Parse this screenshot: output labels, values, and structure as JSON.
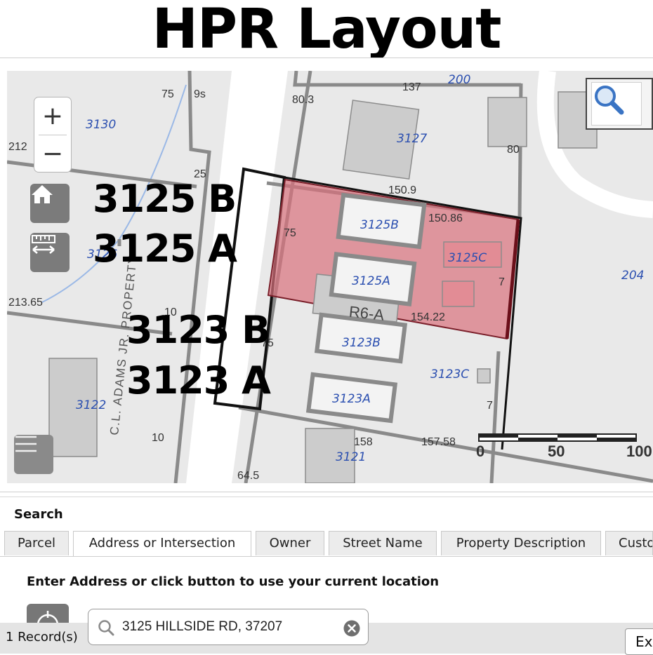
{
  "headline": "HPR Layout",
  "map": {
    "overlay_labels": [
      "3125 B",
      "3125 A",
      "3123 B",
      "3123 A"
    ],
    "parcel_labels": [
      "3130",
      "3127",
      "200",
      "3125B",
      "3125C",
      "3125A",
      "204",
      "3123B",
      "3123C",
      "3123A",
      "3122",
      "3121",
      "3126"
    ],
    "dimension_labels": [
      "75",
      "9s",
      "80.3",
      "137",
      "80",
      "212",
      "25",
      "150.9",
      "150.86",
      "75",
      "7",
      "213.65",
      "10",
      "154.22",
      "75",
      "7",
      "10",
      "158",
      "157.58",
      "64.5"
    ],
    "zoning_label": "R6-A",
    "road_label": "C.L. ADAMS JR. PROPERTY",
    "scale": {
      "labels": [
        "0",
        "50",
        "100"
      ]
    },
    "highlight_color": "#d9707c",
    "parcel_label_color": "#2b4fb0"
  },
  "controls": {
    "zoom_in": "+",
    "zoom_out": "−",
    "icons": [
      "home-icon",
      "measure-icon",
      "menu-icon",
      "magnifier-icon"
    ]
  },
  "panel": {
    "title": "Search",
    "tabs": [
      "Parcel",
      "Address or Intersection",
      "Owner",
      "Street Name",
      "Property Description",
      "Custo"
    ],
    "active_tab": "Address or Intersection",
    "instruction": "Enter Address or click button to use your current location",
    "search_value": "3125 HILLSIDE RD, 37207",
    "records": "1 Record(s)",
    "export_label": "Ex"
  }
}
